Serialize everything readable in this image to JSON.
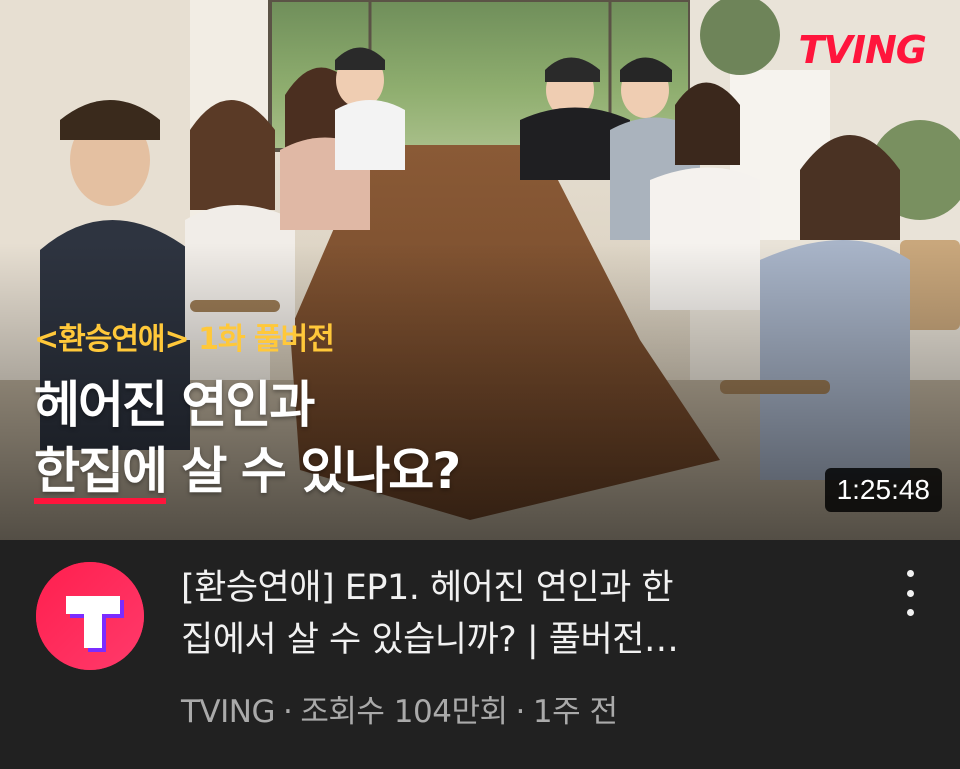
{
  "video": {
    "thumbnail": {
      "brand_logo": "TVING",
      "overlay_sub": "<환승연애> 1화 풀버전",
      "overlay_line1": "헤어진 연인과",
      "overlay_line2_underlined": "한집에",
      "overlay_line2_rest": " 살 수 있나요?",
      "duration": "1:25:48"
    },
    "title_line1": "[환승연애] EP1. 헤어진 연인과 한",
    "title_line2": "집에서 살 수 있습니까? | 풀버전…",
    "channel": "TVING",
    "views": "조회수 104만회",
    "age": "1주 전",
    "separator": "·",
    "avatar_letter": "T"
  },
  "colors": {
    "brand_red": "#ff153c",
    "overlay_yellow": "#ffc83a",
    "background": "#212121",
    "avatar_pink": "#ff1f4e",
    "avatar_purple": "#7b2cff"
  },
  "icons": {
    "more": "more-vert-icon"
  }
}
